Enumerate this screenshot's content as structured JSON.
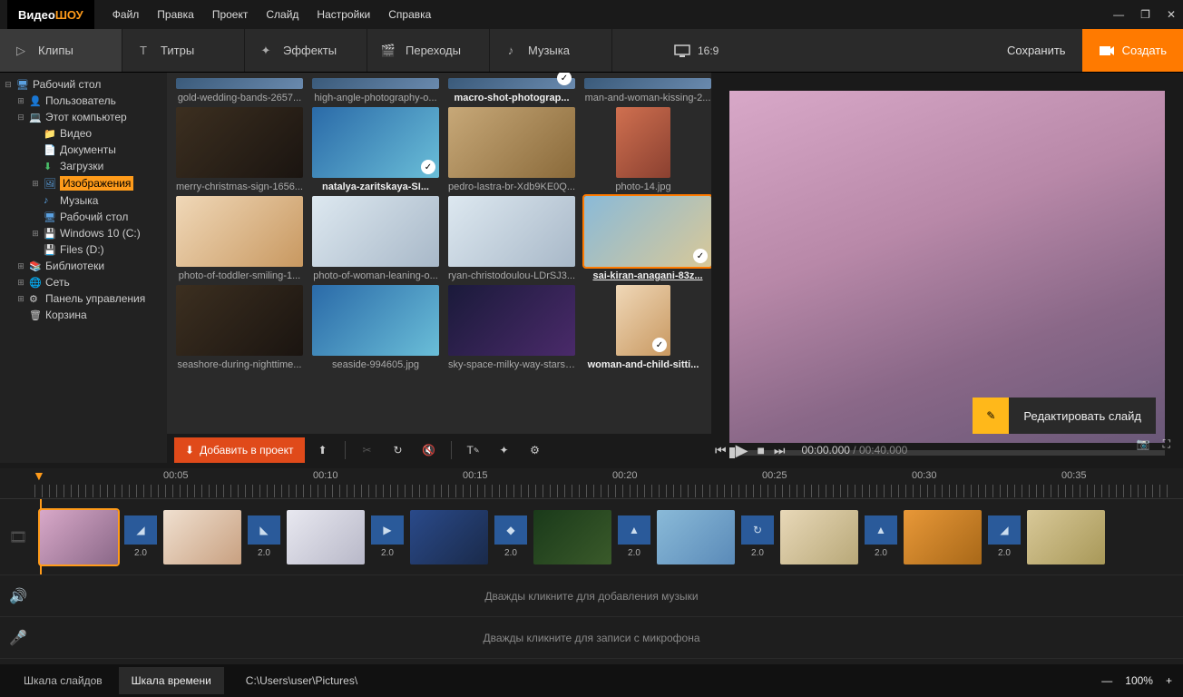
{
  "app": {
    "name1": "Видео",
    "name2": "ШОУ"
  },
  "menu": [
    "Файл",
    "Правка",
    "Проект",
    "Слайд",
    "Настройки",
    "Справка"
  ],
  "tabs": [
    {
      "label": "Клипы",
      "icon": "play"
    },
    {
      "label": "Титры",
      "icon": "text"
    },
    {
      "label": "Эффекты",
      "icon": "wand"
    },
    {
      "label": "Переходы",
      "icon": "slate"
    },
    {
      "label": "Музыка",
      "icon": "note"
    }
  ],
  "aspect": "16:9",
  "actions": {
    "save": "Сохранить",
    "create": "Создать"
  },
  "tree": [
    {
      "lvl": 0,
      "exp": "-",
      "icon": "🖥",
      "label": "Рабочий стол",
      "color": "#5aa0e0"
    },
    {
      "lvl": 1,
      "exp": "+",
      "icon": "👤",
      "label": "Пользователь"
    },
    {
      "lvl": 1,
      "exp": "-",
      "icon": "💻",
      "label": "Этот компьютер",
      "color": "#5aa0e0"
    },
    {
      "lvl": 2,
      "exp": "",
      "icon": "📁",
      "label": "Видео"
    },
    {
      "lvl": 2,
      "exp": "",
      "icon": "📄",
      "label": "Документы"
    },
    {
      "lvl": 2,
      "exp": "",
      "icon": "⬇",
      "label": "Загрузки",
      "color": "#4ac06a"
    },
    {
      "lvl": 2,
      "exp": "+",
      "icon": "🖼",
      "label": "Изображения",
      "sel": true,
      "color": "#5aa0e0"
    },
    {
      "lvl": 2,
      "exp": "",
      "icon": "♪",
      "label": "Музыка",
      "color": "#5aa0e0"
    },
    {
      "lvl": 2,
      "exp": "",
      "icon": "🖥",
      "label": "Рабочий стол",
      "color": "#5aa0e0"
    },
    {
      "lvl": 2,
      "exp": "+",
      "icon": "💾",
      "label": "Windows 10 (C:)"
    },
    {
      "lvl": 2,
      "exp": "",
      "icon": "💾",
      "label": "Files (D:)"
    },
    {
      "lvl": 1,
      "exp": "+",
      "icon": "📚",
      "label": "Библиотеки"
    },
    {
      "lvl": 1,
      "exp": "+",
      "icon": "🌐",
      "label": "Сеть"
    },
    {
      "lvl": 1,
      "exp": "+",
      "icon": "⚙",
      "label": "Панель управления"
    },
    {
      "lvl": 1,
      "exp": "",
      "icon": "🗑",
      "label": "Корзина"
    }
  ],
  "gallery": [
    [
      {
        "name": "gold-wedding-bands-2657...",
        "short": true
      },
      {
        "name": "high-angle-photography-o...",
        "short": true
      },
      {
        "name": "macro-shot-photograp...",
        "bold": true,
        "check": true,
        "short": true
      },
      {
        "name": "man-and-woman-kissing-2...",
        "short": true
      }
    ],
    [
      {
        "name": "merry-christmas-sign-1656...",
        "cls": "t1"
      },
      {
        "name": "natalya-zaritskaya-SI...",
        "bold": true,
        "check": true,
        "cls": "t2"
      },
      {
        "name": "pedro-lastra-br-Xdb9KE0Q...",
        "cls": "t3"
      },
      {
        "name": "photo-14.jpg",
        "portrait": true,
        "cls": "t4"
      }
    ],
    [
      {
        "name": "photo-of-toddler-smiling-1...",
        "cls": "t7"
      },
      {
        "name": "photo-of-woman-leaning-o...",
        "cls": "t5"
      },
      {
        "name": "ryan-christodoulou-LDrSJ3...",
        "cls": "t5"
      },
      {
        "name": "sai-kiran-anagani-83z...",
        "sel": true,
        "bold": true,
        "check": true,
        "cls": "t8"
      }
    ],
    [
      {
        "name": "seashore-during-nighttime...",
        "cls": "t1"
      },
      {
        "name": "seaside-994605.jpg",
        "cls": "t2"
      },
      {
        "name": "sky-space-milky-way-stars-...",
        "cls": "t6"
      },
      {
        "name": "woman-and-child-sitti...",
        "bold": true,
        "check": true,
        "portrait": true,
        "cls": "t7"
      }
    ]
  ],
  "addProject": "Добавить в проект",
  "editSlide": "Редактировать слайд",
  "playback": {
    "current": "00:00.000",
    "total": "00:40.000",
    "sep": " / "
  },
  "ruler": [
    "00:05",
    "00:10",
    "00:15",
    "00:20",
    "00:25",
    "00:30",
    "00:35"
  ],
  "transDur": "2.0",
  "hints": {
    "music": "Дважды кликните для добавления музыки",
    "mic": "Дважды кликните для записи с микрофона"
  },
  "status": {
    "slides": "Шкала слайдов",
    "time": "Шкала времени",
    "path": "C:\\Users\\user\\Pictures\\",
    "zoom": "100%"
  }
}
